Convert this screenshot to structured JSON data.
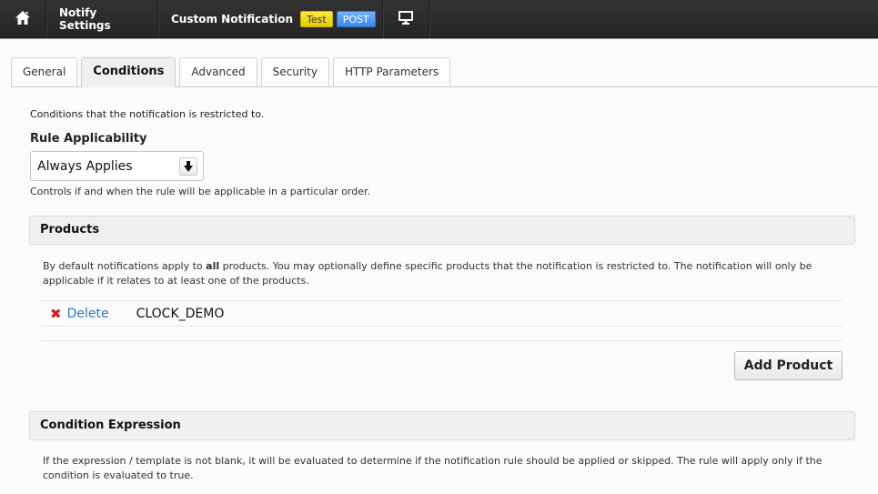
{
  "navbar": {
    "home_icon": "home-icon",
    "notify_settings": "Notify Settings",
    "custom_notification": "Custom Notification",
    "badges": [
      "Test",
      "POST"
    ],
    "screen_icon": "monitor-icon",
    "colors": {
      "background": "#2b2b2b",
      "test_badge": "#f5dd1c",
      "post_badge": "#4a95f4"
    }
  },
  "tabs": [
    {
      "label": "General",
      "active": false
    },
    {
      "label": "Conditions",
      "active": true
    },
    {
      "label": "Advanced",
      "active": false
    },
    {
      "label": "Security",
      "active": false
    },
    {
      "label": "HTTP Parameters",
      "active": false
    }
  ],
  "conditions": {
    "intro": "Conditions that the notification is restricted to.",
    "rule_label": "Rule Applicability",
    "rule_value": "Always Applies",
    "rule_arrow": "🡇",
    "rule_help": "Controls if and when the rule will be applicable in a particular order."
  },
  "products": {
    "header": "Products",
    "description": "By default notifications apply to all products. You may optionally define specific products that the notification is restricted to. The notification will only be applicable if it relates to at least one of the products.",
    "items": [
      {
        "delete_icon": "✖",
        "delete_label": "Delete",
        "name": "CLOCK_DEMO"
      }
    ],
    "add_button": "Add Product",
    "colors": {
      "delete_icon": "#e0171b",
      "delete_link": "#2a78d0"
    }
  },
  "condition_expression": {
    "header": "Condition Expression",
    "description": "If the expression / template is not blank, it will be evaluated to determine if the notification rule should be applied or skipped. The rule will apply only if the condition is evaluated to true."
  }
}
